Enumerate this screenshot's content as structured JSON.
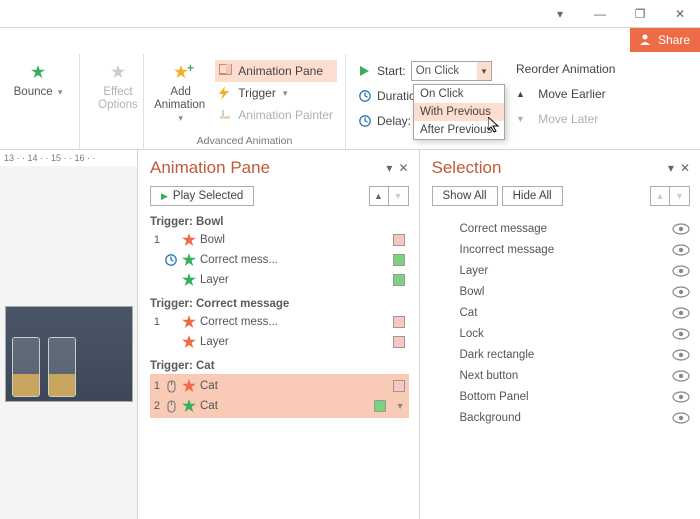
{
  "titlebar": {
    "min": "—",
    "restore": "❐",
    "close": "✕"
  },
  "share": {
    "label": "Share"
  },
  "ribbon": {
    "bounce": "Bounce",
    "effect_options": "Effect\nOptions",
    "add_animation": "Add\nAnimation",
    "animation_pane": "Animation Pane",
    "trigger": "Trigger",
    "animation_painter": "Animation Painter",
    "adv_label": "Advanced Animation",
    "start_lbl": "Start:",
    "start_val": "On Click",
    "duration_lbl": "Duration:",
    "delay_lbl": "Delay:",
    "reorder": "Reorder Animation",
    "move_earlier": "Move Earlier",
    "move_later": "Move Later",
    "start_opts": [
      "On Click",
      "With Previous",
      "After Previous"
    ]
  },
  "ruler": "13 · · 14 · · 15 · · 16 · ·",
  "anim_pane": {
    "title": "Animation Pane",
    "play": "Play Selected",
    "groups": [
      {
        "trigger": "Trigger: Bowl",
        "rows": [
          {
            "idx": "1",
            "ic": "",
            "star": "r",
            "name": "Bowl",
            "bar": "r"
          },
          {
            "idx": "",
            "ic": "clock",
            "star": "g",
            "name": "Correct mess...",
            "bar": "g"
          },
          {
            "idx": "",
            "ic": "",
            "star": "g",
            "name": "Layer",
            "bar": "g"
          }
        ]
      },
      {
        "trigger": "Trigger: Correct message",
        "rows": [
          {
            "idx": "1",
            "ic": "",
            "star": "r",
            "name": "Correct mess...",
            "bar": "r"
          },
          {
            "idx": "",
            "ic": "",
            "star": "r",
            "name": "Layer",
            "bar": "r"
          }
        ]
      },
      {
        "trigger": "Trigger: Cat",
        "selected": true,
        "rows": [
          {
            "idx": "1",
            "ic": "mouse",
            "star": "r",
            "name": "Cat",
            "bar": "r"
          },
          {
            "idx": "2",
            "ic": "mouse",
            "star": "g",
            "name": "Cat",
            "bar": "g",
            "caret": true
          }
        ]
      }
    ]
  },
  "sel_pane": {
    "title": "Selection",
    "show_all": "Show All",
    "hide_all": "Hide All",
    "items": [
      "Correct message",
      "Incorrect message",
      "Layer",
      "Bowl",
      "Cat",
      "Lock",
      "Dark rectangle",
      "Next button",
      "Bottom Panel",
      "Background"
    ]
  }
}
